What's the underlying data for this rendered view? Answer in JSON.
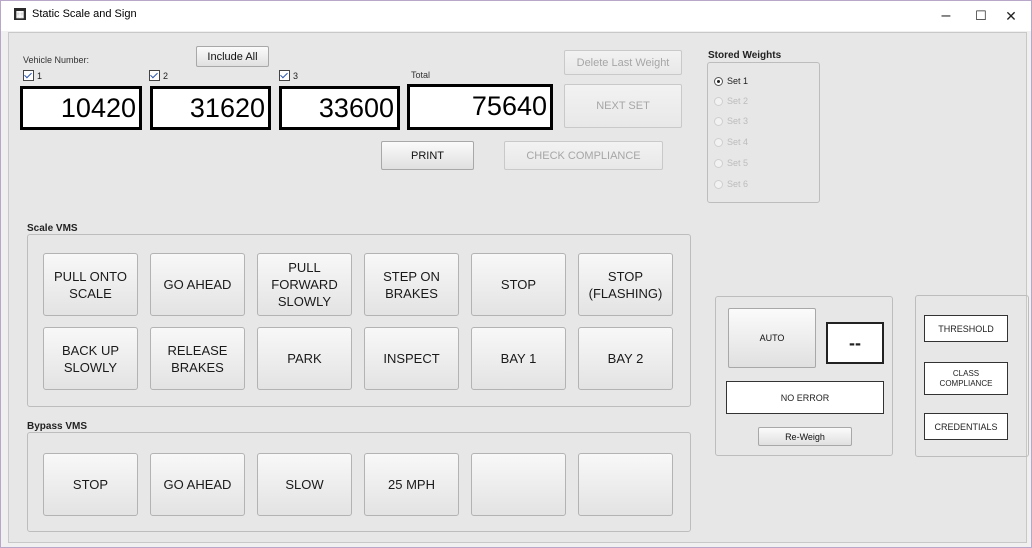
{
  "window": {
    "title": "Static Scale and Sign",
    "icon_glyph": "▦",
    "minimize": "–",
    "maximize": "☐",
    "close": "✕"
  },
  "vehicle": {
    "label": "Vehicle Number:",
    "include_all": "Include All",
    "axles": [
      {
        "label": "1",
        "weight": "10420",
        "checked": true
      },
      {
        "label": "2",
        "weight": "31620",
        "checked": true
      },
      {
        "label": "3",
        "weight": "33600",
        "checked": true
      }
    ],
    "total_label": "Total",
    "total": "75640"
  },
  "actions": {
    "delete_last": "Delete Last Weight",
    "next_set": "NEXT SET",
    "print": "PRINT",
    "check_compliance": "CHECK COMPLIANCE"
  },
  "stored_weights": {
    "title": "Stored Weights",
    "sets": [
      "Set 1",
      "Set 2",
      "Set 3",
      "Set 4",
      "Set 5",
      "Set 6"
    ],
    "selected": "Set 1"
  },
  "scale_vms": {
    "title": "Scale VMS",
    "buttons": [
      "PULL ONTO\nSCALE",
      "GO AHEAD",
      "PULL\nFORWARD\nSLOWLY",
      "STEP ON\nBRAKES",
      "STOP",
      "STOP\n(FLASHING)",
      "BACK UP\nSLOWLY",
      "RELEASE\nBRAKES",
      "PARK",
      "INSPECT",
      "BAY 1",
      "BAY 2"
    ]
  },
  "bypass_vms": {
    "title": "Bypass VMS",
    "buttons": [
      "STOP",
      "GO AHEAD",
      "SLOW",
      "25 MPH",
      "",
      ""
    ]
  },
  "auto_panel": {
    "auto": "AUTO",
    "display": "--",
    "status": "NO ERROR",
    "reweigh": "Re-Weigh"
  },
  "right_panel": {
    "threshold": "THRESHOLD",
    "class_compliance": "CLASS\nCOMPLIANCE",
    "credentials": "CREDENTIALS"
  }
}
